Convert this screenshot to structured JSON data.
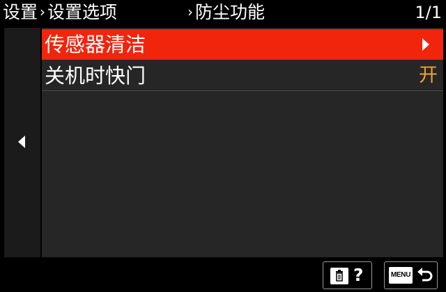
{
  "header": {
    "breadcrumb_1": "设置",
    "breadcrumb_sep_1": "›",
    "breadcrumb_2": "设置选项",
    "breadcrumb_sep_2": "›",
    "breadcrumb_3": "防尘功能",
    "page_counter": "1/1"
  },
  "menu": {
    "items": [
      {
        "label": "传感器清洁",
        "selected": true,
        "indicator": "chevron-right-icon"
      },
      {
        "label": "关机时快门",
        "value": "开"
      }
    ]
  },
  "footer": {
    "help_label": "?",
    "menu_label": "MENU",
    "delete_icon": "trash-icon",
    "back_icon": "return-arrow-icon"
  },
  "colors": {
    "selected_bg": "#f1240c",
    "value_text": "#f2a12e",
    "panel_bg": "#262626"
  }
}
